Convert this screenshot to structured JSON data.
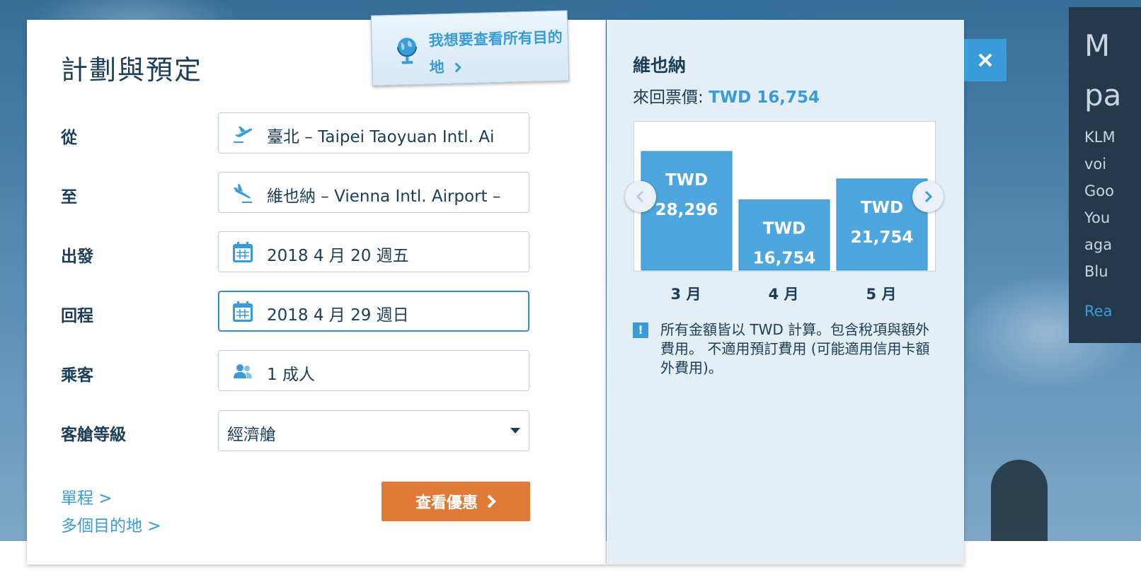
{
  "form": {
    "title": "計劃與預定",
    "explore_link": "我想要查看所有目的地",
    "fields": {
      "from_label": "從",
      "from_value": "臺北 – Taipei Taoyuan Intl. Ai",
      "to_label": "至",
      "to_value": "維也納 – Vienna Intl. Airport –",
      "depart_label": "出發",
      "depart_value": "2018 4 月 20 週五",
      "return_label": "回程",
      "return_value": "2018 4 月 29 週日",
      "passengers_label": "乘客",
      "passengers_value": "1 成人",
      "cabin_label": "客艙等級",
      "cabin_value": "經濟艙"
    },
    "links": {
      "one_way": "單程 >",
      "multi_city": "多個目的地 >"
    },
    "cta_label": "查看優惠"
  },
  "summary": {
    "destination": "維也納",
    "fare_label": "來回票價: ",
    "fare_amount": "TWD 16,754",
    "notice": "所有金額皆以 TWD 計算。包含稅項與額外費用。 不適用預訂費用 (可能適用信用卡額外費用)。"
  },
  "chart_data": {
    "type": "bar",
    "categories": [
      "3 月",
      "4 月",
      "5 月"
    ],
    "values": [
      28296,
      16754,
      21754
    ],
    "value_labels": [
      [
        "TWD",
        "28,296"
      ],
      [
        "TWD",
        "16,754"
      ],
      [
        "TWD",
        "21,754"
      ]
    ],
    "title": "",
    "xlabel": "",
    "ylabel": "",
    "ylim": [
      0,
      30000
    ],
    "grid": false,
    "bar_color": "#4ea6df"
  },
  "promo": {
    "heading_lines": [
      "M",
      "pa"
    ],
    "body_lines": [
      "KLM",
      "voi",
      "Goo",
      "You",
      "aga",
      "Blu"
    ],
    "read_more": "Rea"
  },
  "colors": {
    "accent": "#3a9bd9",
    "cta": "#e07a38",
    "text": "#1b3d58",
    "panel": "#e4eef5"
  },
  "icons": {
    "from": "plane-departure-icon",
    "to": "plane-arrival-icon",
    "date": "calendar-icon",
    "passengers": "passengers-icon",
    "explore": "globe-icon",
    "close": "close-icon",
    "notice": "info-icon"
  }
}
